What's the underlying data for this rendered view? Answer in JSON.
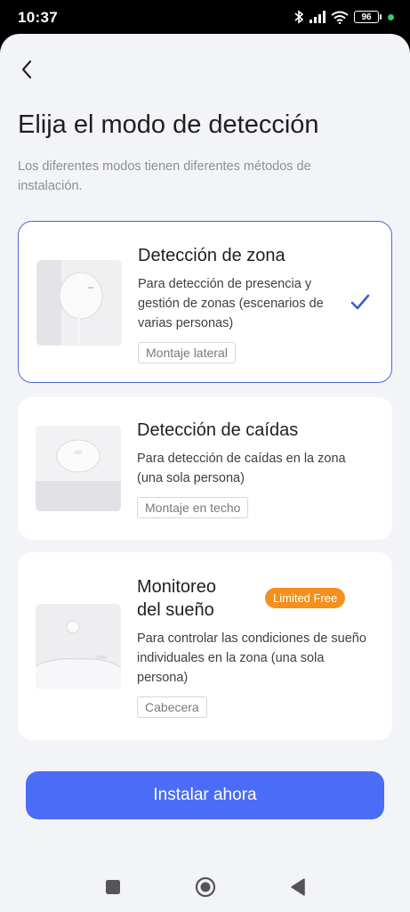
{
  "status_bar": {
    "time": "10:37",
    "battery": "96"
  },
  "header": {
    "title": "Elija el modo de detección",
    "subtitle": "Los diferentes modos tienen diferentes métodos de instalación."
  },
  "modes": [
    {
      "title": "Detección de zona",
      "description": "Para detección de presencia y gestión de zonas (escenarios de varias personas)",
      "tag": "Montaje lateral",
      "selected": true
    },
    {
      "title": "Detección de caídas",
      "description": "Para detección de caídas en la zona (una sola persona)",
      "tag": "Montaje en techo",
      "selected": false
    },
    {
      "title_line1": "Monitoreo",
      "title_line2": "del sueño",
      "badge": "Limited Free",
      "description": "Para controlar las condiciones de sueño individuales en la zona (una sola persona)",
      "tag": "Cabecera",
      "selected": false
    }
  ],
  "install_button": {
    "label": "Instalar ahora"
  },
  "colors": {
    "accent": "#4a6cf7",
    "selected_border": "#4a6bd4",
    "badge": "#f5901e",
    "background": "#f3f4f8"
  },
  "icons": [
    "back-arrow-icon",
    "checkmark-icon",
    "bluetooth-icon",
    "signal-icon",
    "wifi-icon",
    "battery-icon",
    "nav-square-icon",
    "nav-home-icon",
    "nav-back-icon"
  ]
}
